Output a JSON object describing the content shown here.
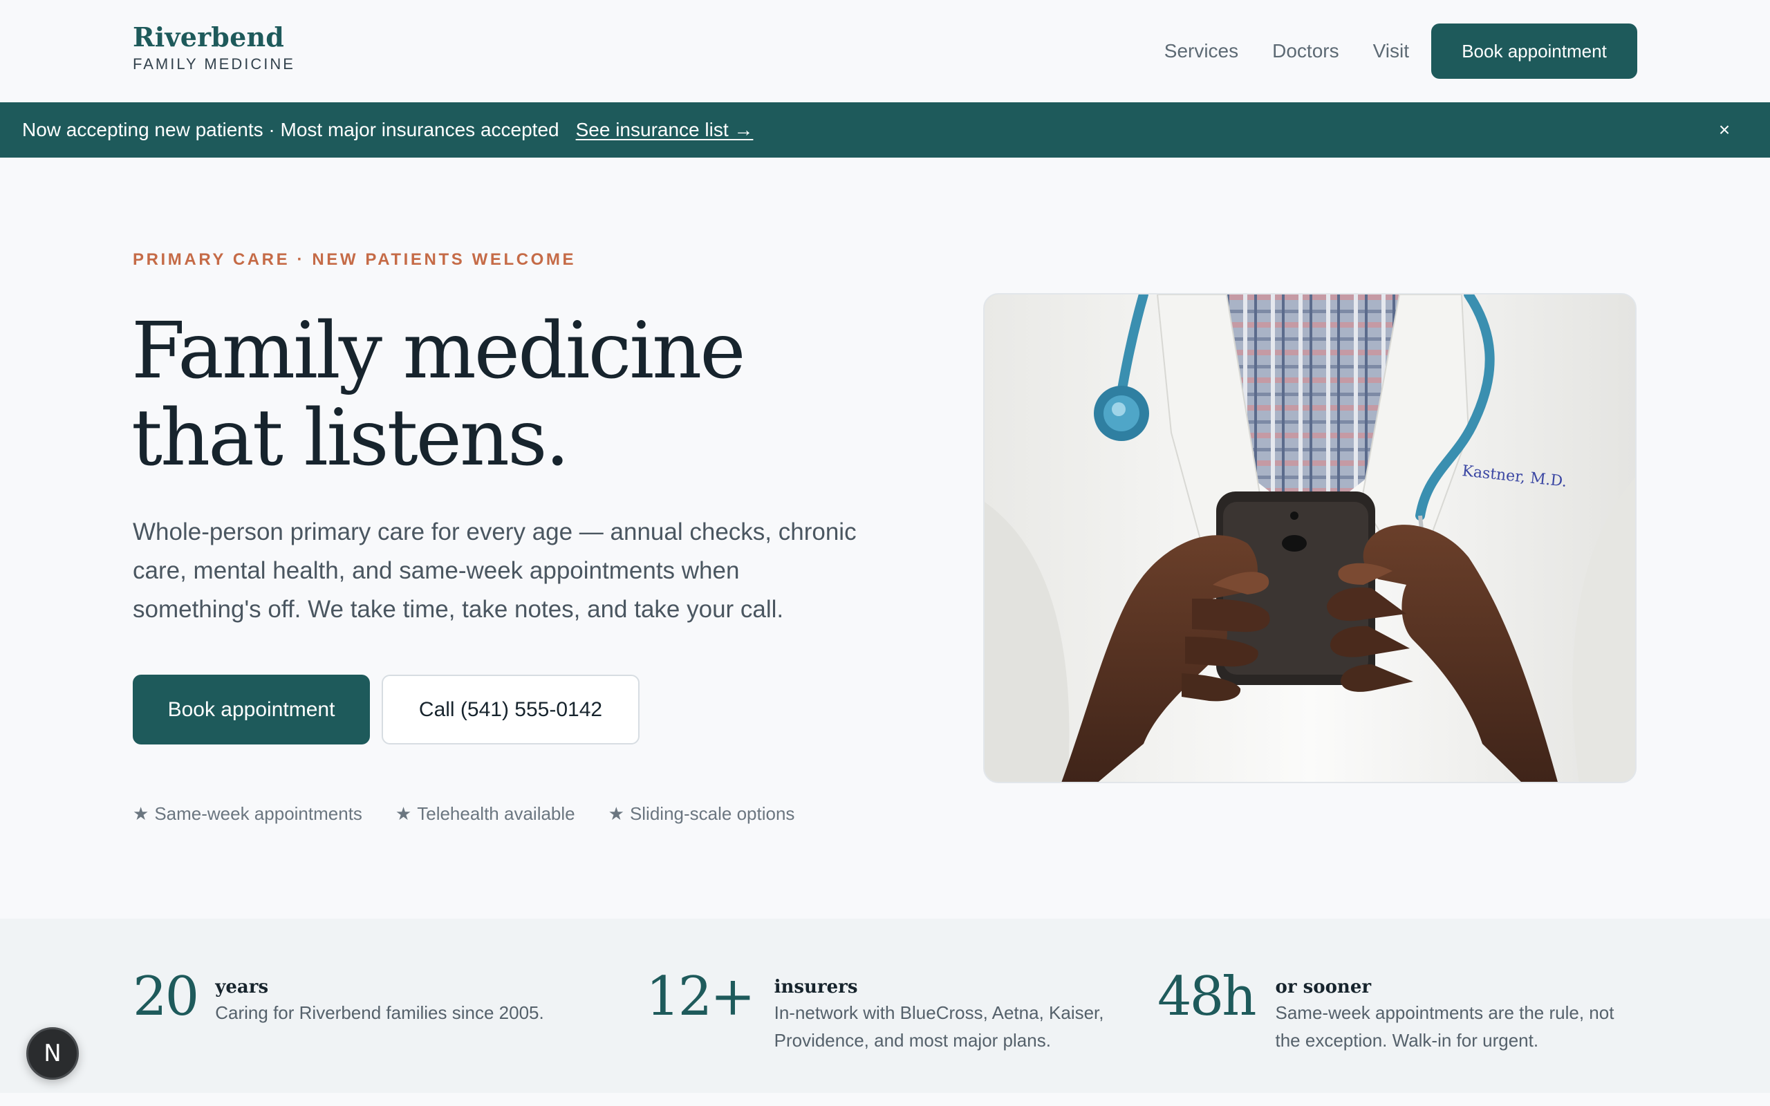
{
  "brand": {
    "name": "Riverbend",
    "subtitle": "FAMILY MEDICINE"
  },
  "nav": {
    "links": [
      "Services",
      "Doctors",
      "Visit"
    ],
    "cta_label": "Book appointment"
  },
  "announcement": {
    "text": "Now accepting new patients · Most major insurances accepted",
    "link_label": "See insurance list →",
    "close_icon": "close-icon",
    "close_glyph": "×"
  },
  "hero": {
    "eyebrow": "PRIMARY CARE · NEW PATIENTS WELCOME",
    "title": "Family medicine that listens.",
    "lead": "Whole-person primary care for every age — annual checks, chronic care, mental health, and same-week appointments when something's off. We take time, take notes, and take your call.",
    "primary_cta": "Book appointment",
    "secondary_cta": "Call (541) 555-0142",
    "features": [
      "Same-week appointments",
      "Telehealth available",
      "Sliding-scale options"
    ],
    "feature_icon": "star-icon",
    "image_alt": "Doctor in white coat with stethoscope holding a smartphone"
  },
  "stats": [
    {
      "number": "20",
      "label": "years",
      "description": "Caring for Riverbend families since 2005."
    },
    {
      "number": "12+",
      "label": "insurers",
      "description": "In-network with BlueCross, Aetna, Kaiser, Providence, and most major plans."
    },
    {
      "number": "48h",
      "label": "or sooner",
      "description": "Same-week appointments are the rule, not the exception. Walk-in for urgent."
    }
  ],
  "fab": {
    "glyph": "N",
    "icon": "n-logo-icon"
  },
  "colors": {
    "brand": "#1e5a5b",
    "accent": "#c56b47",
    "background": "#f8f9fb",
    "stats_band": "#f0f3f5"
  }
}
